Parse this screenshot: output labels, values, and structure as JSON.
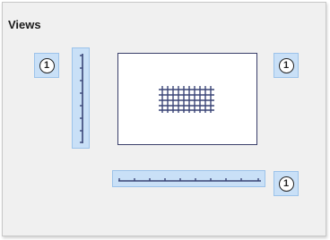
{
  "panel": {
    "title": "Views"
  },
  "badges": {
    "left_ruler": "1",
    "page": "1",
    "bottom_ruler": "1"
  },
  "colors": {
    "accent_fill": "#c9e0f7",
    "accent_border": "#9cc3ea",
    "ruler_ink": "#3a4577"
  },
  "icons": {
    "vertical_ruler": "vertical-ruler-icon",
    "horizontal_ruler": "horizontal-ruler-icon",
    "grid": "grid-icon",
    "badge": "numbered-circle-icon"
  }
}
